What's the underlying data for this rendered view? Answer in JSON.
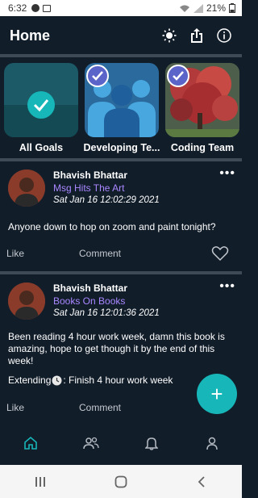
{
  "status_bar": {
    "time": "6:32",
    "battery": "21%"
  },
  "header": {
    "title": "Home"
  },
  "goals": [
    {
      "label": "All Goals"
    },
    {
      "label": "Developing Te..."
    },
    {
      "label": "Coding Team"
    }
  ],
  "posts": [
    {
      "author": "Bhavish  Bhattar",
      "group": "Msg Hits The Art",
      "date": "Sat Jan 16 12:02:29 2021",
      "body": "Anyone down to hop on zoom and paint tonight?",
      "like": "Like",
      "comment": "Comment"
    },
    {
      "author": "Bhavish  Bhattar",
      "group": "Books On Books",
      "date": "Sat Jan 16 12:01:36 2021",
      "body": "Been reading 4 hour work week, damn this book is amazing, hope to get though it by the end of this week!",
      "extending_prefix": "Extending",
      "extending_text": ": Finish 4 hour work week",
      "like": "Like",
      "comment": "Comment"
    }
  ],
  "fab": {
    "label": "+"
  },
  "colors": {
    "background": "#121d2a",
    "accent": "#17b6b8",
    "group_link": "#a887ff",
    "badge": "#5b64c8"
  }
}
